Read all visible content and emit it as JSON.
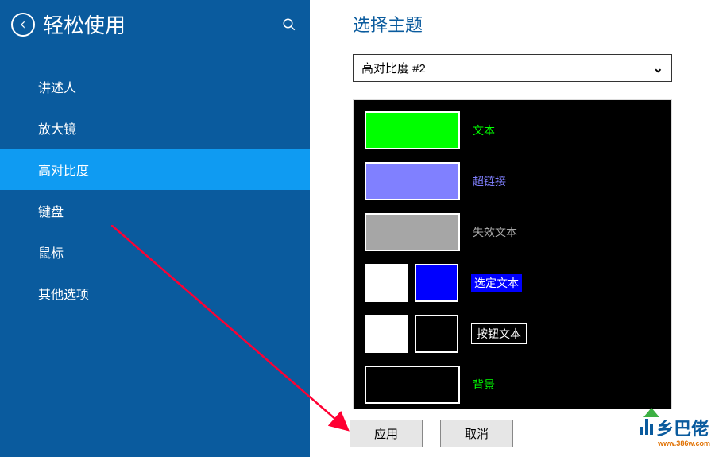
{
  "sidebar": {
    "title": "轻松使用",
    "items": [
      {
        "label": "讲述人"
      },
      {
        "label": "放大镜"
      },
      {
        "label": "高对比度"
      },
      {
        "label": "键盘"
      },
      {
        "label": "鼠标"
      },
      {
        "label": "其他选项"
      }
    ],
    "active_index": 2
  },
  "main": {
    "title": "选择主题",
    "theme_select_value": "高对比度 #2"
  },
  "preview": {
    "text_label": "文本",
    "text_color": "#00ff00",
    "link_label": "超链接",
    "link_color": "#8080ff",
    "disabled_label": "失效文本",
    "disabled_color": "#a6a6a6",
    "selected_label": "选定文本",
    "selected_fg": "#ffffff",
    "selected_bg": "#0000ff",
    "button_label": "按钮文本",
    "button_fg": "#ffffff",
    "button_bg": "#000000",
    "background_label": "背景",
    "background_color": "#000000"
  },
  "buttons": {
    "apply": "应用",
    "cancel": "取消"
  },
  "watermark": {
    "text": "乡巴佬",
    "url": "www.386w.com"
  }
}
